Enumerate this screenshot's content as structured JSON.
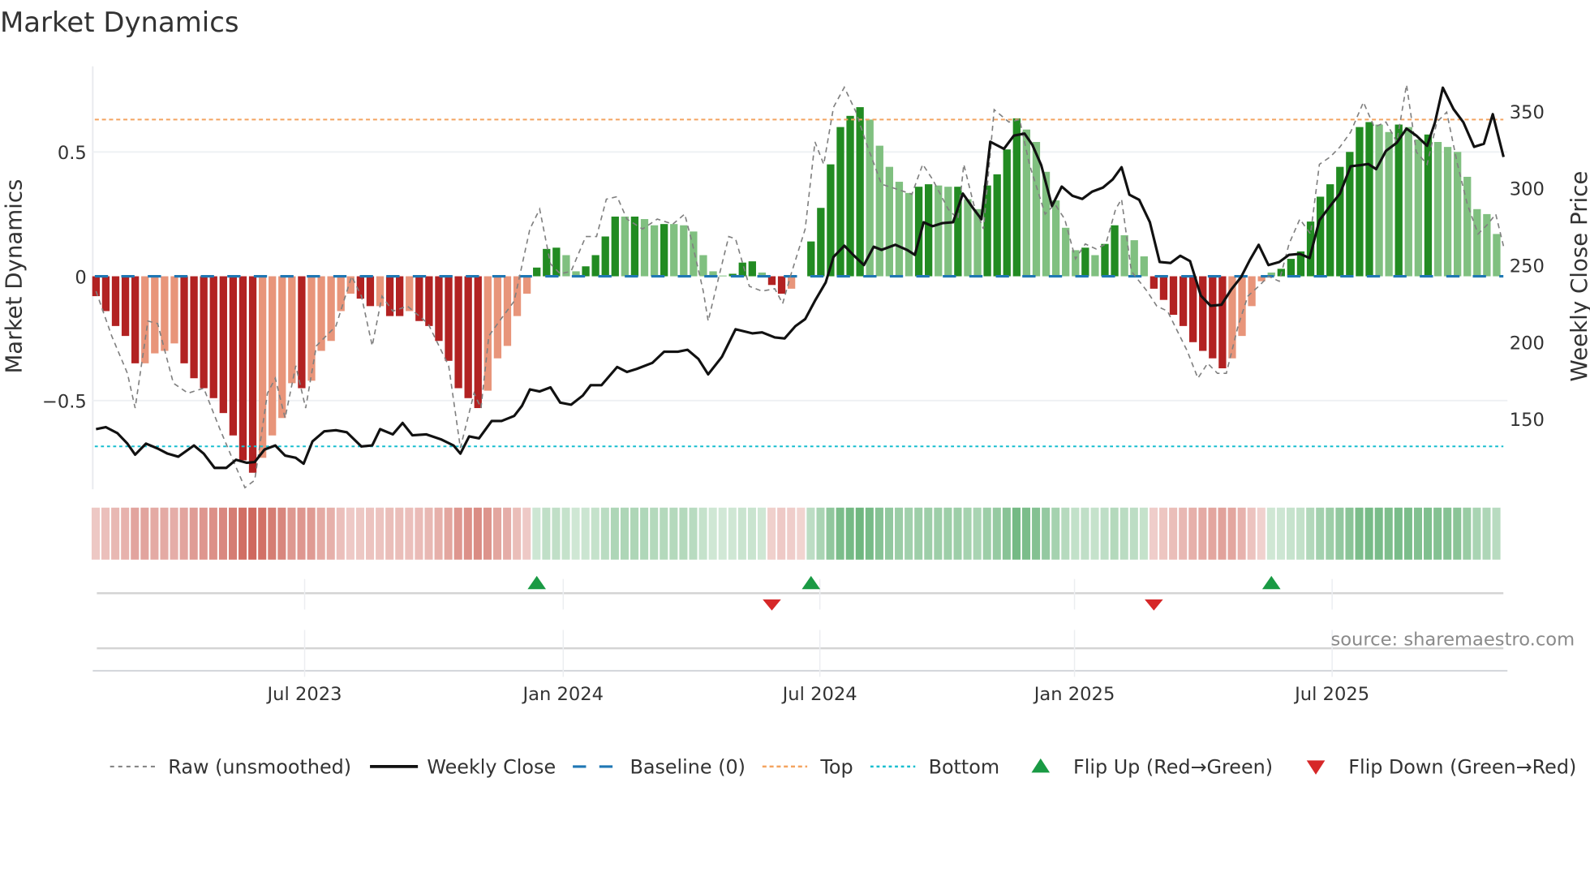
{
  "title": "Market Dynamics",
  "source": "source: sharemaestro.com",
  "colors": {
    "strong_red": "#b22222",
    "weak_red": "#e8957a",
    "strong_green": "#228b22",
    "weak_green": "#80c080",
    "raw": "#808080",
    "close": "#111111",
    "baseline": "#1f77b4",
    "top": "#f4a460",
    "bottom": "#17becf",
    "flip_up": "#1a9a44",
    "flip_down": "#d62728",
    "heat_red": "#c0392b",
    "heat_green": "#2e9646"
  },
  "chart_data": {
    "type": "bar",
    "title": "Market Dynamics",
    "ylabel": "Market Dynamics",
    "y2label": "Weekly Close Price",
    "ylim": [
      -0.86,
      0.8
    ],
    "y2lim": [
      108,
      378
    ],
    "yticks": [
      {
        "v": 0.5,
        "label": "0.5"
      },
      {
        "v": 0,
        "label": "0"
      },
      {
        "v": -0.5,
        "label": "−0.5"
      }
    ],
    "y2ticks": [
      {
        "v": 350,
        "label": "350"
      },
      {
        "v": 300,
        "label": "300"
      },
      {
        "v": 250,
        "label": "250"
      },
      {
        "v": 200,
        "label": "200"
      },
      {
        "v": 150,
        "label": "150"
      }
    ],
    "xticks": [
      {
        "week": 21.3,
        "label": "Jul 2023"
      },
      {
        "week": 47.7,
        "label": "Jan 2024"
      },
      {
        "week": 73.9,
        "label": "Jul 2024"
      },
      {
        "week": 99.9,
        "label": "Jan 2025"
      },
      {
        "week": 126.2,
        "label": "Jul 2025"
      }
    ],
    "top_level": 0.63,
    "bottom_level": -0.684,
    "baseline": 0,
    "bars": [
      -0.08,
      -0.14,
      -0.2,
      -0.24,
      -0.35,
      -0.35,
      -0.31,
      -0.3,
      -0.27,
      -0.35,
      -0.41,
      -0.45,
      -0.49,
      -0.55,
      -0.64,
      -0.74,
      -0.79,
      -0.73,
      -0.64,
      -0.57,
      -0.43,
      -0.45,
      -0.42,
      -0.3,
      -0.26,
      -0.14,
      -0.07,
      -0.09,
      -0.12,
      -0.12,
      -0.16,
      -0.16,
      -0.14,
      -0.18,
      -0.2,
      -0.26,
      -0.34,
      -0.45,
      -0.49,
      -0.53,
      -0.46,
      -0.33,
      -0.28,
      -0.16,
      -0.07,
      0.035,
      0.11,
      0.115,
      0.085,
      0.02,
      0.04,
      0.085,
      0.16,
      0.24,
      0.24,
      0.24,
      0.23,
      0.205,
      0.21,
      0.21,
      0.205,
      0.18,
      0.085,
      0.02,
      0.003,
      0.01,
      0.055,
      0.06,
      0.015,
      -0.035,
      -0.07,
      -0.05,
      0,
      0.14,
      0.275,
      0.45,
      0.6,
      0.645,
      0.68,
      0.63,
      0.525,
      0.44,
      0.38,
      0.335,
      0.36,
      0.37,
      0.365,
      0.36,
      0.36,
      0.31,
      0.27,
      0.365,
      0.41,
      0.51,
      0.635,
      0.59,
      0.54,
      0.42,
      0.305,
      0.195,
      0.105,
      0.115,
      0.085,
      0.13,
      0.205,
      0.165,
      0.145,
      0.08,
      -0.05,
      -0.095,
      -0.155,
      -0.2,
      -0.265,
      -0.3,
      -0.33,
      -0.37,
      -0.33,
      -0.24,
      -0.12,
      -0.02,
      0.015,
      0.03,
      0.07,
      0.1,
      0.22,
      0.32,
      0.37,
      0.44,
      0.5,
      0.6,
      0.62,
      0.61,
      0.58,
      0.61,
      0.6,
      0.55,
      0.57,
      0.54,
      0.52,
      0.5,
      0.4,
      0.27,
      0.25,
      0.17
    ],
    "bar_strong": [
      1,
      1,
      1,
      1,
      1,
      0,
      0,
      0,
      0,
      1,
      1,
      1,
      1,
      1,
      1,
      1,
      1,
      0,
      0,
      0,
      0,
      1,
      0,
      0,
      0,
      0,
      0,
      1,
      1,
      0,
      1,
      1,
      0,
      1,
      1,
      1,
      1,
      1,
      1,
      1,
      0,
      0,
      0,
      0,
      0,
      1,
      1,
      1,
      0,
      0,
      1,
      1,
      1,
      1,
      0,
      1,
      0,
      0,
      1,
      0,
      0,
      0,
      0,
      0,
      0,
      1,
      1,
      1,
      0,
      1,
      1,
      0,
      0,
      1,
      1,
      1,
      1,
      1,
      1,
      0,
      0,
      0,
      0,
      0,
      1,
      1,
      0,
      0,
      1,
      0,
      0,
      1,
      1,
      1,
      1,
      0,
      0,
      0,
      0,
      0,
      0,
      1,
      0,
      1,
      1,
      0,
      0,
      0,
      1,
      1,
      1,
      1,
      1,
      1,
      1,
      1,
      0,
      0,
      0,
      0,
      0,
      1,
      1,
      1,
      1,
      1,
      1,
      1,
      1,
      1,
      1,
      0,
      0,
      1,
      0,
      0,
      1,
      0,
      0,
      0,
      0,
      0,
      0,
      0
    ],
    "raw": [
      [
        0,
        -0.06
      ],
      [
        1.6,
        -0.24
      ],
      [
        3.2,
        -0.39
      ],
      [
        4.0,
        -0.53
      ],
      [
        5.3,
        -0.18
      ],
      [
        6.3,
        -0.19
      ],
      [
        7.9,
        -0.43
      ],
      [
        9.4,
        -0.47
      ],
      [
        11.0,
        -0.45
      ],
      [
        12.6,
        -0.61
      ],
      [
        14.1,
        -0.75
      ],
      [
        15.2,
        -0.85
      ],
      [
        16.2,
        -0.82
      ],
      [
        17.5,
        -0.47
      ],
      [
        18.3,
        -0.41
      ],
      [
        19.3,
        -0.57
      ],
      [
        20.4,
        -0.36
      ],
      [
        21.4,
        -0.53
      ],
      [
        22.5,
        -0.28
      ],
      [
        24.5,
        -0.2
      ],
      [
        26.1,
        0.0
      ],
      [
        27.1,
        -0.08
      ],
      [
        28.2,
        -0.28
      ],
      [
        29.2,
        -0.08
      ],
      [
        30.3,
        -0.14
      ],
      [
        31.8,
        -0.12
      ],
      [
        33.9,
        -0.19
      ],
      [
        36.0,
        -0.36
      ],
      [
        37.2,
        -0.69
      ],
      [
        38.6,
        -0.47
      ],
      [
        39.3,
        -0.53
      ],
      [
        40.1,
        -0.24
      ],
      [
        41.2,
        -0.18
      ],
      [
        42.7,
        -0.1
      ],
      [
        44.3,
        0.19
      ],
      [
        45.3,
        0.27
      ],
      [
        46.4,
        0.05
      ],
      [
        47.4,
        0.01
      ],
      [
        48.5,
        0.02
      ],
      [
        50.0,
        0.16
      ],
      [
        51.1,
        0.16
      ],
      [
        52.1,
        0.31
      ],
      [
        53.2,
        0.32
      ],
      [
        54.2,
        0.23
      ],
      [
        55.8,
        0.19
      ],
      [
        57.3,
        0.23
      ],
      [
        58.9,
        0.21
      ],
      [
        60.1,
        0.25
      ],
      [
        60.9,
        0.13
      ],
      [
        62.0,
        -0.06
      ],
      [
        62.5,
        -0.18
      ],
      [
        63.6,
        0.0
      ],
      [
        64.6,
        0.16
      ],
      [
        65.3,
        0.15
      ],
      [
        66.7,
        -0.04
      ],
      [
        68.0,
        -0.06
      ],
      [
        69.3,
        -0.05
      ],
      [
        70.1,
        -0.11
      ],
      [
        70.9,
        0.0
      ],
      [
        72.4,
        0.19
      ],
      [
        73.4,
        0.54
      ],
      [
        74.3,
        0.45
      ],
      [
        75.3,
        0.68
      ],
      [
        76.4,
        0.76
      ],
      [
        77.6,
        0.66
      ],
      [
        78.6,
        0.54
      ],
      [
        80.2,
        0.37
      ],
      [
        81.8,
        0.35
      ],
      [
        83.3,
        0.33
      ],
      [
        84.4,
        0.45
      ],
      [
        85.4,
        0.39
      ],
      [
        87.0,
        0.27
      ],
      [
        88.0,
        0.23
      ],
      [
        88.6,
        0.45
      ],
      [
        89.6,
        0.29
      ],
      [
        90.6,
        0.19
      ],
      [
        91.7,
        0.67
      ],
      [
        93.2,
        0.62
      ],
      [
        94.3,
        0.63
      ],
      [
        95.3,
        0.45
      ],
      [
        96.9,
        0.25
      ],
      [
        97.9,
        0.29
      ],
      [
        98.9,
        0.23
      ],
      [
        100.0,
        0.07
      ],
      [
        101.0,
        0.13
      ],
      [
        102.1,
        0.11
      ],
      [
        103.1,
        0.13
      ],
      [
        104.1,
        0.27
      ],
      [
        104.7,
        0.31
      ],
      [
        105.7,
        0.02
      ],
      [
        107.3,
        -0.06
      ],
      [
        108.3,
        -0.12
      ],
      [
        109.4,
        -0.14
      ],
      [
        110.4,
        -0.22
      ],
      [
        111.4,
        -0.3
      ],
      [
        112.5,
        -0.41
      ],
      [
        113.5,
        -0.35
      ],
      [
        114.5,
        -0.39
      ],
      [
        115.4,
        -0.39
      ],
      [
        116.6,
        -0.2
      ],
      [
        117.6,
        -0.08
      ],
      [
        118.7,
        -0.04
      ],
      [
        119.7,
        0.0
      ],
      [
        120.8,
        -0.02
      ],
      [
        121.8,
        0.13
      ],
      [
        122.9,
        0.23
      ],
      [
        124.0,
        0.17
      ],
      [
        124.9,
        0.45
      ],
      [
        126.0,
        0.48
      ],
      [
        127.0,
        0.52
      ],
      [
        128.1,
        0.58
      ],
      [
        129.4,
        0.7
      ],
      [
        130.5,
        0.6
      ],
      [
        131.7,
        0.62
      ],
      [
        132.8,
        0.54
      ],
      [
        133.8,
        0.77
      ],
      [
        134.8,
        0.5
      ],
      [
        135.9,
        0.45
      ],
      [
        136.9,
        0.62
      ],
      [
        137.9,
        0.66
      ],
      [
        139.0,
        0.45
      ],
      [
        140.0,
        0.29
      ],
      [
        141.1,
        0.17
      ],
      [
        142.1,
        0.21
      ],
      [
        142.9,
        0.25
      ],
      [
        143.7,
        0.12
      ]
    ],
    "close": [
      [
        0,
        143.4
      ],
      [
        1.0,
        144.7
      ],
      [
        2.2,
        140.7
      ],
      [
        3.2,
        134
      ],
      [
        4.0,
        126.8
      ],
      [
        5.1,
        134
      ],
      [
        6.3,
        130.8
      ],
      [
        7.3,
        127.5
      ],
      [
        8.4,
        125.5
      ],
      [
        10.0,
        132.8
      ],
      [
        11.0,
        127.5
      ],
      [
        12.1,
        118.2
      ],
      [
        13.3,
        118.2
      ],
      [
        14.3,
        123.5
      ],
      [
        15.4,
        121.5
      ],
      [
        16.2,
        122
      ],
      [
        17.2,
        130.1
      ],
      [
        18.3,
        132.8
      ],
      [
        19.3,
        126.2
      ],
      [
        20.4,
        124.8
      ],
      [
        21.2,
        120.9
      ],
      [
        22.1,
        135.4
      ],
      [
        23.3,
        142
      ],
      [
        24.5,
        142.7
      ],
      [
        25.6,
        141.4
      ],
      [
        27.1,
        132.1
      ],
      [
        28.2,
        132.8
      ],
      [
        29.0,
        143.4
      ],
      [
        30.3,
        140
      ],
      [
        31.3,
        147.4
      ],
      [
        32.3,
        139.4
      ],
      [
        33.7,
        140
      ],
      [
        35.2,
        136.8
      ],
      [
        36.5,
        132.8
      ],
      [
        37.2,
        127.5
      ],
      [
        38.1,
        138.7
      ],
      [
        39.1,
        137.4
      ],
      [
        40.4,
        148.7
      ],
      [
        41.4,
        148.7
      ],
      [
        42.7,
        152
      ],
      [
        43.5,
        158.6
      ],
      [
        44.3,
        169.2
      ],
      [
        45.3,
        167.9
      ],
      [
        46.4,
        170.5
      ],
      [
        47.4,
        160.6
      ],
      [
        48.5,
        159.3
      ],
      [
        49.7,
        165.2
      ],
      [
        50.5,
        171.9
      ],
      [
        51.6,
        171.9
      ],
      [
        53.2,
        183.8
      ],
      [
        54.2,
        180.5
      ],
      [
        55.2,
        182.5
      ],
      [
        56.8,
        186.4
      ],
      [
        58.0,
        193.7
      ],
      [
        59.4,
        193.7
      ],
      [
        60.4,
        195
      ],
      [
        61.5,
        189
      ],
      [
        62.5,
        179
      ],
      [
        63.9,
        190.4
      ],
      [
        65.3,
        208.3
      ],
      [
        67.0,
        205.6
      ],
      [
        68.0,
        206.3
      ],
      [
        69.3,
        203
      ],
      [
        70.3,
        202.3
      ],
      [
        71.4,
        210.3
      ],
      [
        72.4,
        214.9
      ],
      [
        73.4,
        226.8
      ],
      [
        74.5,
        238.7
      ],
      [
        75.3,
        255.3
      ],
      [
        76.4,
        262.6
      ],
      [
        77.4,
        256
      ],
      [
        78.4,
        250
      ],
      [
        79.4,
        261.9
      ],
      [
        80.2,
        259.9
      ],
      [
        81.6,
        263.2
      ],
      [
        82.8,
        259.9
      ],
      [
        83.6,
        256.6
      ],
      [
        84.5,
        277.8
      ],
      [
        85.4,
        275.2
      ],
      [
        86.4,
        277.2
      ],
      [
        87.5,
        277.8
      ],
      [
        88.5,
        296.4
      ],
      [
        89.6,
        286.4
      ],
      [
        90.4,
        279.8
      ],
      [
        91.3,
        330.1
      ],
      [
        92.7,
        325.5
      ],
      [
        93.7,
        334.1
      ],
      [
        94.8,
        335.4
      ],
      [
        95.6,
        328.1
      ],
      [
        96.5,
        314.9
      ],
      [
        97.6,
        288.4
      ],
      [
        98.6,
        301
      ],
      [
        99.7,
        295
      ],
      [
        100.7,
        293
      ],
      [
        101.7,
        297.7
      ],
      [
        102.8,
        300.3
      ],
      [
        103.8,
        305.6
      ],
      [
        104.7,
        313.6
      ],
      [
        105.5,
        295.7
      ],
      [
        106.5,
        292.4
      ],
      [
        107.6,
        277.8
      ],
      [
        108.6,
        252
      ],
      [
        109.7,
        251.3
      ],
      [
        110.7,
        256
      ],
      [
        111.7,
        252.6
      ],
      [
        112.8,
        230.1
      ],
      [
        113.8,
        223.5
      ],
      [
        114.9,
        224.2
      ],
      [
        115.9,
        234.1
      ],
      [
        116.9,
        242.1
      ],
      [
        117.8,
        253.3
      ],
      [
        118.7,
        263.2
      ],
      [
        119.7,
        250
      ],
      [
        120.8,
        252
      ],
      [
        121.8,
        256.6
      ],
      [
        122.9,
        257.3
      ],
      [
        123.9,
        254.6
      ],
      [
        124.9,
        279.1
      ],
      [
        126.0,
        288.4
      ],
      [
        127.0,
        296.4
      ],
      [
        128.1,
        314.2
      ],
      [
        129.1,
        314.9
      ],
      [
        129.9,
        315.6
      ],
      [
        130.7,
        312.3
      ],
      [
        131.7,
        324.2
      ],
      [
        132.8,
        329.5
      ],
      [
        133.8,
        338.7
      ],
      [
        134.8,
        334.1
      ],
      [
        135.9,
        327.5
      ],
      [
        136.7,
        342.7
      ],
      [
        137.5,
        365.2
      ],
      [
        138.6,
        351.3
      ],
      [
        139.6,
        342.7
      ],
      [
        140.7,
        326.8
      ],
      [
        141.7,
        328.8
      ],
      [
        142.6,
        348
      ],
      [
        143.7,
        320.2
      ]
    ],
    "flip_up_weeks": [
      45,
      73,
      120
    ],
    "flip_down_weeks": [
      69,
      108
    ],
    "legend": {
      "raw": "Raw (unsmoothed)",
      "close": "Weekly Close",
      "baseline": "Baseline (0)",
      "top": "Top",
      "bottom": "Bottom",
      "flip_up": "Flip Up (Red→Green)",
      "flip_down": "Flip Down (Green→Red)"
    }
  }
}
